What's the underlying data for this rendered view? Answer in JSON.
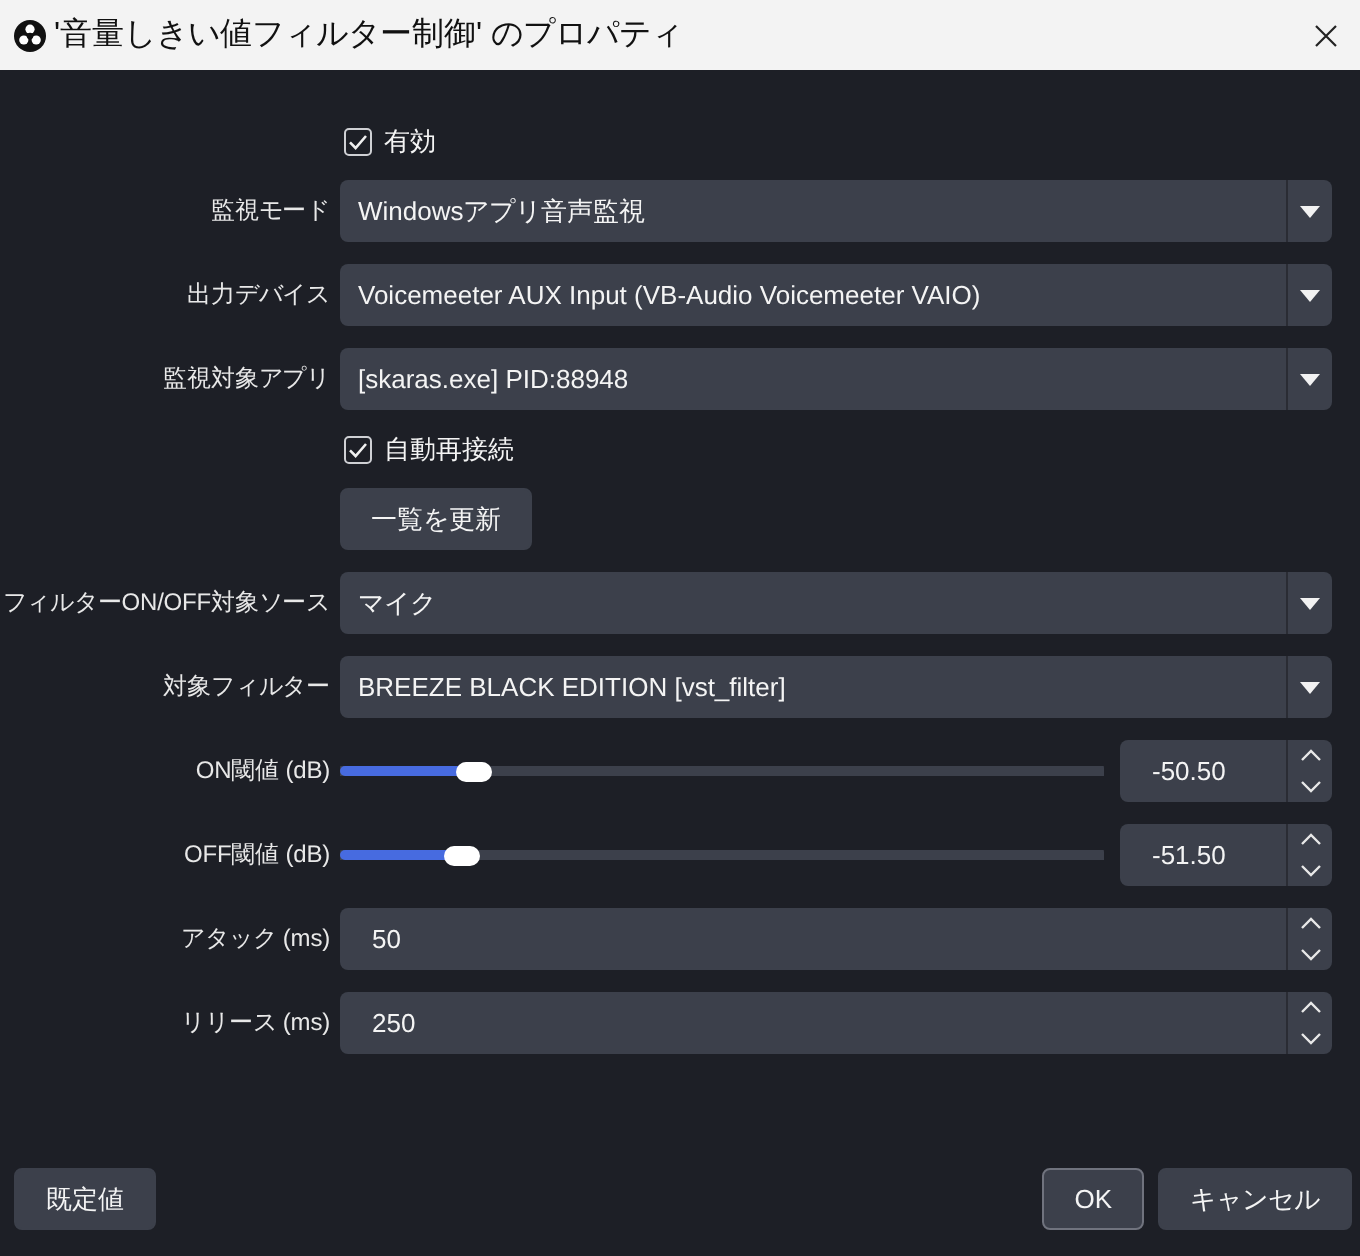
{
  "window": {
    "title": "'音量しきい値フィルター制御' のプロパティ"
  },
  "fields": [
    {
      "kind": "checkbox",
      "label": "有効",
      "checked": true
    },
    {
      "kind": "dropdown",
      "label": "監視モード",
      "value": "Windowsアプリ音声監視"
    },
    {
      "kind": "dropdown",
      "label": "出力デバイス",
      "value": "Voicemeeter AUX Input (VB-Audio Voicemeeter VAIO)"
    },
    {
      "kind": "dropdown",
      "label": "監視対象アプリ",
      "value": "[skaras.exe] PID:88948"
    },
    {
      "kind": "checkbox",
      "label": "自動再接続",
      "checked": true
    },
    {
      "kind": "button",
      "label": "一覧を更新"
    },
    {
      "kind": "dropdown",
      "label": "フィルターON/OFF対象ソース",
      "value": "マイク"
    },
    {
      "kind": "dropdown",
      "label": "対象フィルター",
      "value": "BREEZE BLACK EDITION [vst_filter]"
    },
    {
      "kind": "slider",
      "label": "ON閾値 (dB)",
      "level": 0.158,
      "value": "-50.50"
    },
    {
      "kind": "slider",
      "label": "OFF閾値 (dB)",
      "level": 0.142,
      "value": "-51.50"
    },
    {
      "kind": "spinbox",
      "label": "アタック (ms)",
      "value": "50"
    },
    {
      "kind": "spinbox",
      "label": "リリース (ms)",
      "value": "250"
    }
  ],
  "footer": {
    "left_buttons": [
      {
        "label": "既定値",
        "default": false
      }
    ],
    "right_buttons": [
      {
        "label": "OK",
        "default": true
      },
      {
        "label": "キャンセル",
        "default": false
      }
    ]
  }
}
